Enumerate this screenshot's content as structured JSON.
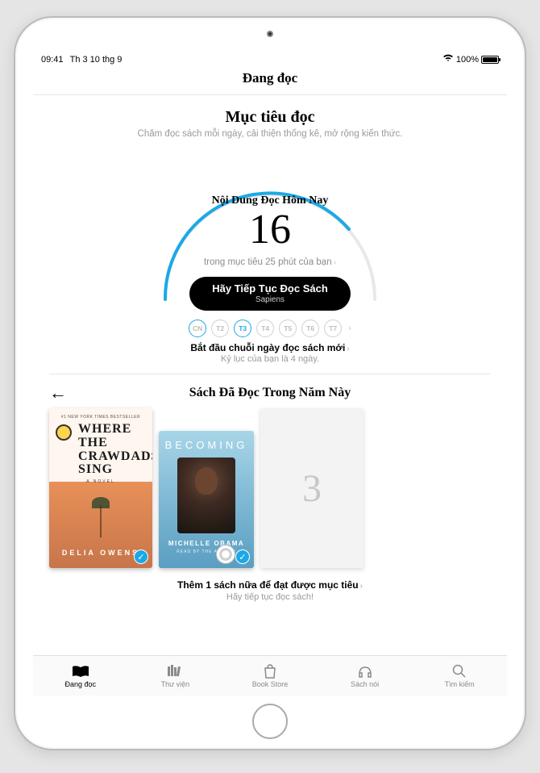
{
  "statusbar": {
    "time": "09:41",
    "date": "Th 3 10 thg 9",
    "battery": "100%"
  },
  "nav": {
    "title": "Đang đọc"
  },
  "goals": {
    "title": "Mục tiêu đọc",
    "subtitle": "Chăm đọc sách mỗi ngày, cải thiện thống kê, mở rộng kiến thức.",
    "today_label": "Nội Dung Đọc Hôm Nay",
    "minutes": "16",
    "of_goal": "trong mục tiêu 25 phút của bạn",
    "keep_reading": "Hãy Tiếp Tục Đọc Sách",
    "current_book": "Sapiens",
    "days": [
      "CN",
      "T2",
      "T3",
      "T4",
      "T5",
      "T6",
      "T7"
    ],
    "streak_title": "Bắt đầu chuỗi ngày đọc sách mới",
    "streak_sub": "Kỷ lục của bạn là 4 ngày."
  },
  "year": {
    "title": "Sách Đã Đọc Trong Năm Này",
    "book1_bestseller": "#1 NEW YORK TIMES BESTSELLER",
    "book1_title": "WHERE\nTHE\nCRAWDADS\nSING",
    "book1_novel": "A NOVEL",
    "book1_author": "DELIA OWENS",
    "book2_title": "BECOMING",
    "book2_author": "MICHELLE OBAMA",
    "book2_reader": "READ BY THE AUTHOR",
    "placeholder": "3",
    "foot_main": "Thêm 1 sách nữa để đạt được mục tiêu",
    "foot_sub": "Hãy tiếp tục đọc sách!"
  },
  "tabs": {
    "reading": "Đang đọc",
    "library": "Thư viện",
    "store": "Book Store",
    "audio": "Sách nói",
    "search": "Tìm kiếm"
  }
}
